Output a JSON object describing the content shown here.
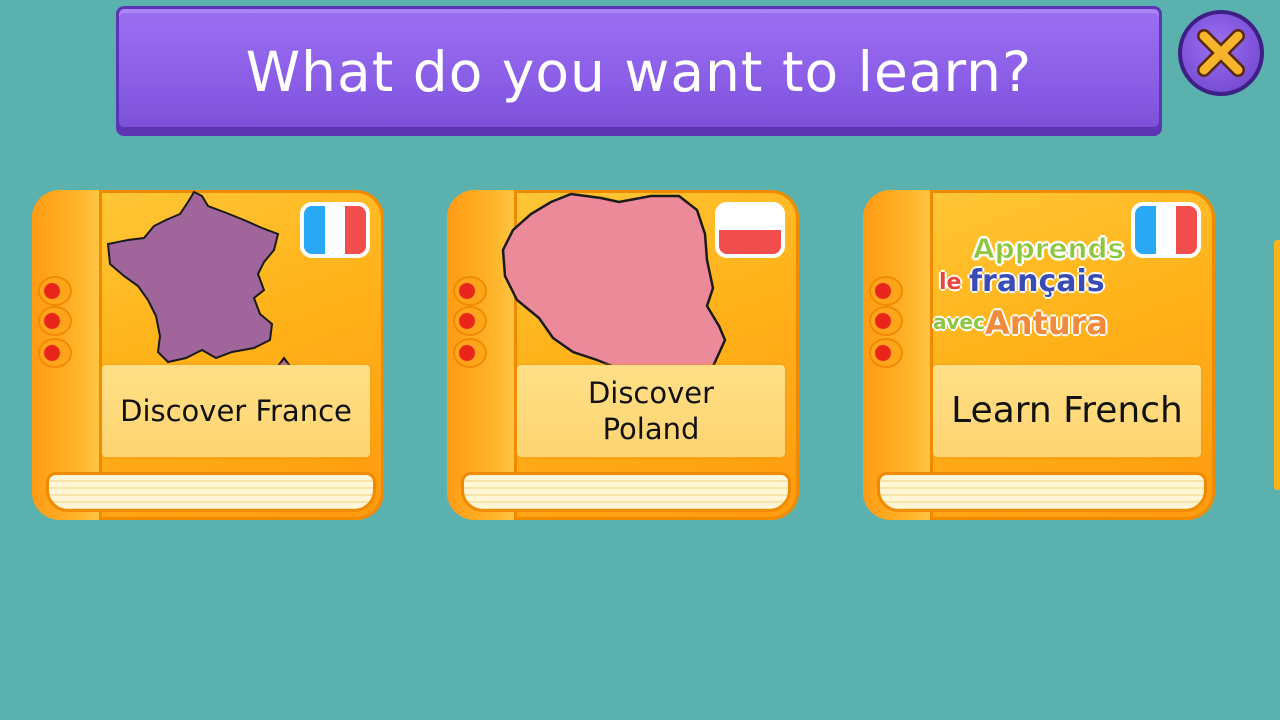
{
  "header": {
    "title": "What do you want to learn?"
  },
  "close_button": {
    "icon": "close-icon",
    "color": "#f7b52b"
  },
  "cards": [
    {
      "label": "Discover France",
      "flag": "france-flag",
      "map": "france-map-icon",
      "map_color": "#a0669b"
    },
    {
      "label": "Discover Poland",
      "flag": "poland-flag",
      "map": "poland-map-icon",
      "map_color": "#ec8a9a"
    },
    {
      "label": "Learn French",
      "flag": "france-flag",
      "logo": {
        "line1": "Apprends",
        "line2a": "le",
        "line2b": "français",
        "line3a": "avec",
        "line3b": "Antura"
      }
    }
  ],
  "colors": {
    "background": "#5bb1ae",
    "banner": "#8a5de6",
    "book": "#ffb31a",
    "flag_blue": "#29a9f5",
    "flag_red": "#f24d4d"
  }
}
